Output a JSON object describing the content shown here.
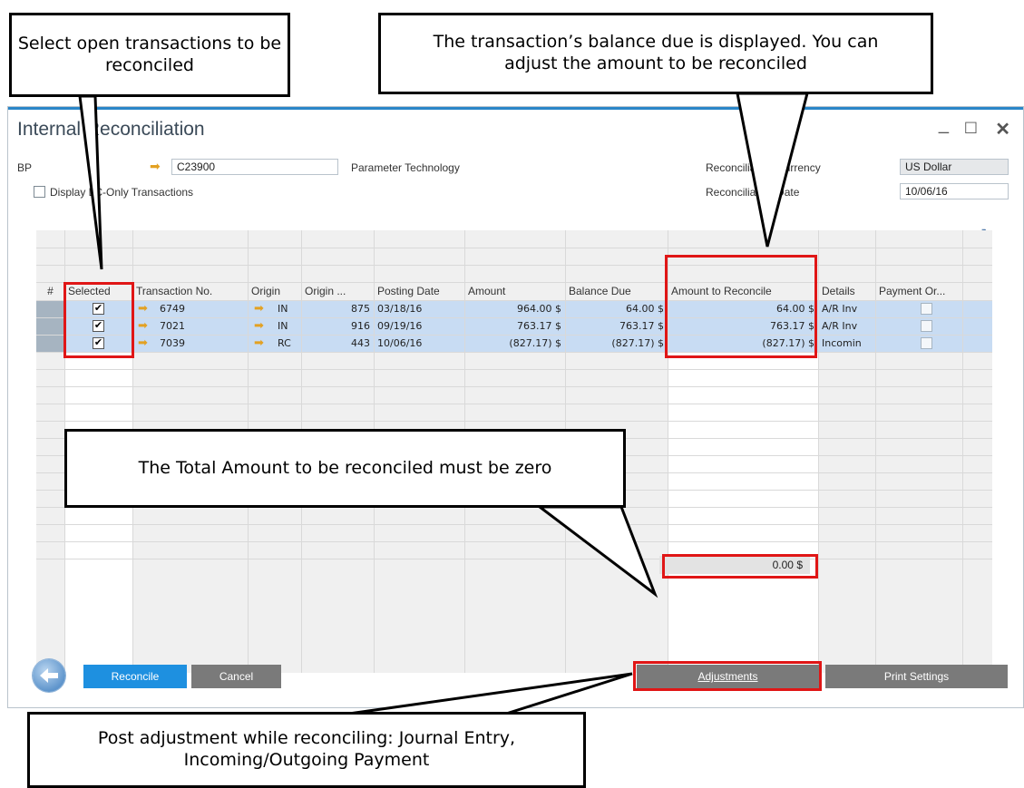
{
  "window": {
    "title": "Internal Reconciliation",
    "bp_label": "BP",
    "bp_code": "C23900",
    "bp_name": "Parameter Technology",
    "display_checkbox_label": "Display LC-Only Transactions",
    "currency_label": "Reconciliation Currency",
    "currency_value": "US Dollar",
    "date_label": "Reconciliation Date",
    "date_value": "10/06/16"
  },
  "grid": {
    "columns": [
      "#",
      "Selected",
      "Transaction No.",
      "Origin",
      "Origin ...",
      "Posting Date",
      "Amount",
      "Balance Due",
      "Amount to Reconcile",
      "Details",
      "Payment Or..."
    ],
    "rows": [
      {
        "selected": true,
        "transaction_no": "6749",
        "origin": "IN",
        "origin_no": "875",
        "posting_date": "03/18/16",
        "amount": "964.00 $",
        "balance_due": "64.00 $",
        "amount_to_reconcile": "64.00 $",
        "details": "A/R Inv"
      },
      {
        "selected": true,
        "transaction_no": "7021",
        "origin": "IN",
        "origin_no": "916",
        "posting_date": "09/19/16",
        "amount": "763.17 $",
        "balance_due": "763.17 $",
        "amount_to_reconcile": "763.17 $",
        "details": "A/R Inv"
      },
      {
        "selected": true,
        "transaction_no": "7039",
        "origin": "RC",
        "origin_no": "443",
        "posting_date": "10/06/16",
        "amount": "(827.17) $",
        "balance_due": "(827.17) $",
        "amount_to_reconcile": "(827.17) $",
        "details": "Incomin"
      }
    ],
    "total": "0.00 $"
  },
  "buttons": {
    "reconcile": "Reconcile",
    "cancel": "Cancel",
    "adjustments": "Adjustments",
    "print_settings": "Print Settings"
  },
  "callouts": {
    "select": "Select open transactions to be reconciled",
    "balance": "The transaction’s balance due is displayed. You can adjust the amount to be reconciled",
    "total": "The Total Amount to be reconciled must be zero",
    "adjust": "Post adjustment while reconciling: Journal Entry, Incoming/Outgoing Payment"
  },
  "colors": {
    "highlight": "#e01616",
    "accent": "#2a86c8",
    "selected_row": "#c8dcf3"
  }
}
